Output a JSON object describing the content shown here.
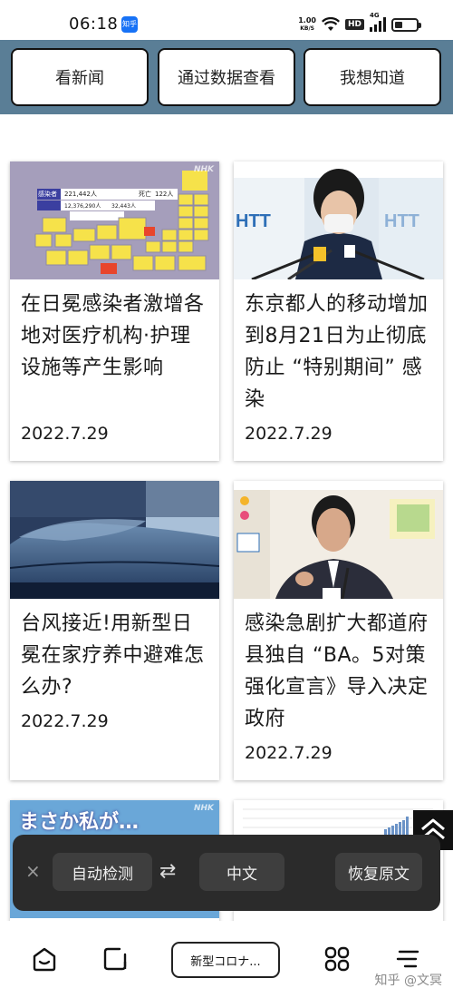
{
  "status_bar": {
    "time": "06:18",
    "app_icon_text": "知乎",
    "net_speed_value": "1.00",
    "net_speed_unit": "KB/S",
    "hd_label": "HD",
    "signal_label": "4G"
  },
  "top_nav": {
    "buttons": [
      {
        "label": "看新闻"
      },
      {
        "label": "通过数据查看"
      },
      {
        "label": "我想知道"
      }
    ]
  },
  "articles": [
    {
      "title": "在日冕感染者激增各地对医疗机构·护理设施等产生影响",
      "date": "2022.7.29",
      "image": "covid-japan-map"
    },
    {
      "title": "东京都人的移动增加到8月21日为止彻底防止 “特别期间” 感染",
      "date": "2022.7.29",
      "image": "tokyo-governor-press"
    },
    {
      "title": "台风接近!用新型日冕在家疗养中避难怎么办?",
      "date": "2022.7.29",
      "image": "bedroom-futon"
    },
    {
      "title": "感染急剧扩大都道府县独自 “BA。5对策强化宣言》导入决定政府",
      "date": "2022.7.29",
      "image": "minister-press"
    },
    {
      "title": "",
      "date": "",
      "image": "masaka-banner",
      "partial_text": "まさか私が…"
    },
    {
      "title": "",
      "date": "",
      "image": "chart-thumbnail"
    }
  ],
  "image_watermark": "NHK",
  "map_panel": {
    "label_infected": "感染者",
    "infected": "221,442人",
    "label_deaths": "死亡",
    "deaths": "122人",
    "cumulative": "12,376,290人",
    "deaths_cumulative": "32,443人"
  },
  "translate_bar": {
    "close_label": "×",
    "source_lang": "自动检测",
    "swap_label": "⇄",
    "target_lang": "中文",
    "restore_label": "恢复原文"
  },
  "bottom_bar": {
    "tab_title": "新型コロナ...",
    "watermark": "知乎 @文冥"
  },
  "icons": [
    "home-icon",
    "tab-switch-icon",
    "apps-grid-icon",
    "menu-icon",
    "scroll-top-icon"
  ],
  "colors": {
    "nav_band": "#5a7e96",
    "translate_bg": "#2b2b2b",
    "translate_pill": "#3e3e3e",
    "app_badge": "#1772f6"
  }
}
